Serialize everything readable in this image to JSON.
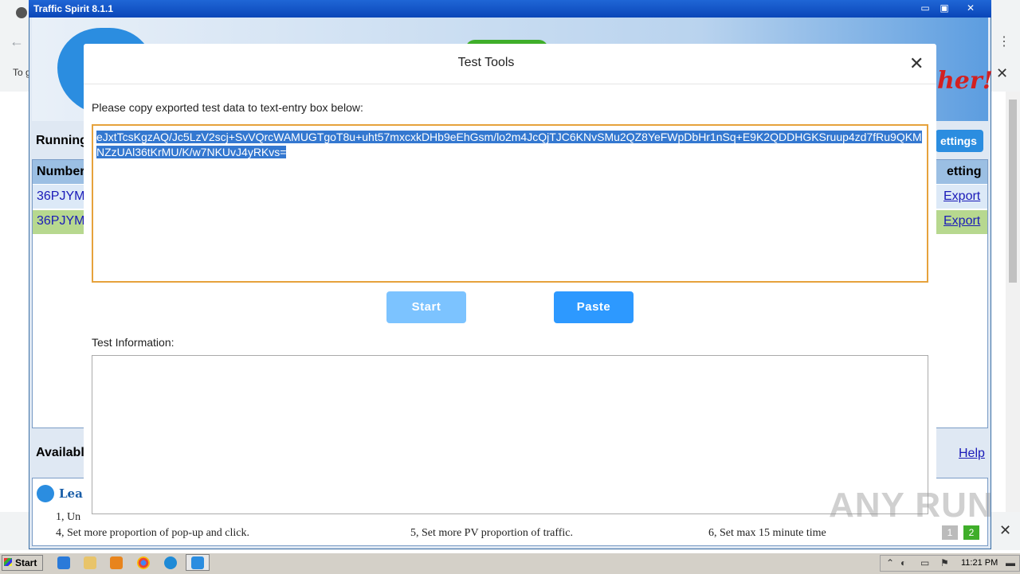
{
  "browser": {
    "left_stub_text": "To g",
    "back_glyph": "←",
    "menu_glyph": "⋮",
    "close_glyph": "✕"
  },
  "app": {
    "title": "Traffic Spirit 8.1.1",
    "minimize": "▭",
    "maximize": "▣",
    "close": "✕",
    "header_slogan": "her!",
    "running_label": "Running",
    "settings_label": "ettings",
    "table": {
      "col_number": "Number",
      "col_setting": "etting",
      "rows": [
        {
          "id": "36PJYM",
          "action": "Export"
        },
        {
          "id": "36PJYM",
          "action": "Export"
        }
      ]
    },
    "available_label": "Availabl",
    "help_label": "Help",
    "learn_label": "Lea",
    "tips": {
      "tip1": "1, Un",
      "tip4": "4, Set more proportion of pop-up and click.",
      "tip5": "5, Set more PV proportion of traffic.",
      "tip6": "6, Set max 15 minute time"
    },
    "pager": [
      "1",
      "2"
    ]
  },
  "modal": {
    "title": "Test Tools",
    "close_glyph": "✕",
    "instruction": "Please copy exported test data to text-entry box below:",
    "textarea_value": "eJxtTcsKgzAQ/Jc5LzV2scj+SvVQrcWAMUGTgoT8u+uht57mxcxkDHb9eEhGsm/lo2m4JcQjTJC6KNvSMu2QZ8YeFWpDbHr1nSq+E9K2QDDHGKSruup4zd7fRu9QKMNZzUAl36tKrMU/K/w7NKUvJ4yRKvs=",
    "start_label": "Start",
    "paste_label": "Paste",
    "info_label": "Test Information:",
    "info_value": ""
  },
  "watermark": "ANY RUN",
  "taskbar": {
    "start_label": "Start",
    "clock": "11:21 PM"
  },
  "colors": {
    "accent_orange": "#e6a23c",
    "button_blue": "#2d99ff",
    "button_disabled": "#7cc3ff",
    "selection": "#3478d0"
  }
}
